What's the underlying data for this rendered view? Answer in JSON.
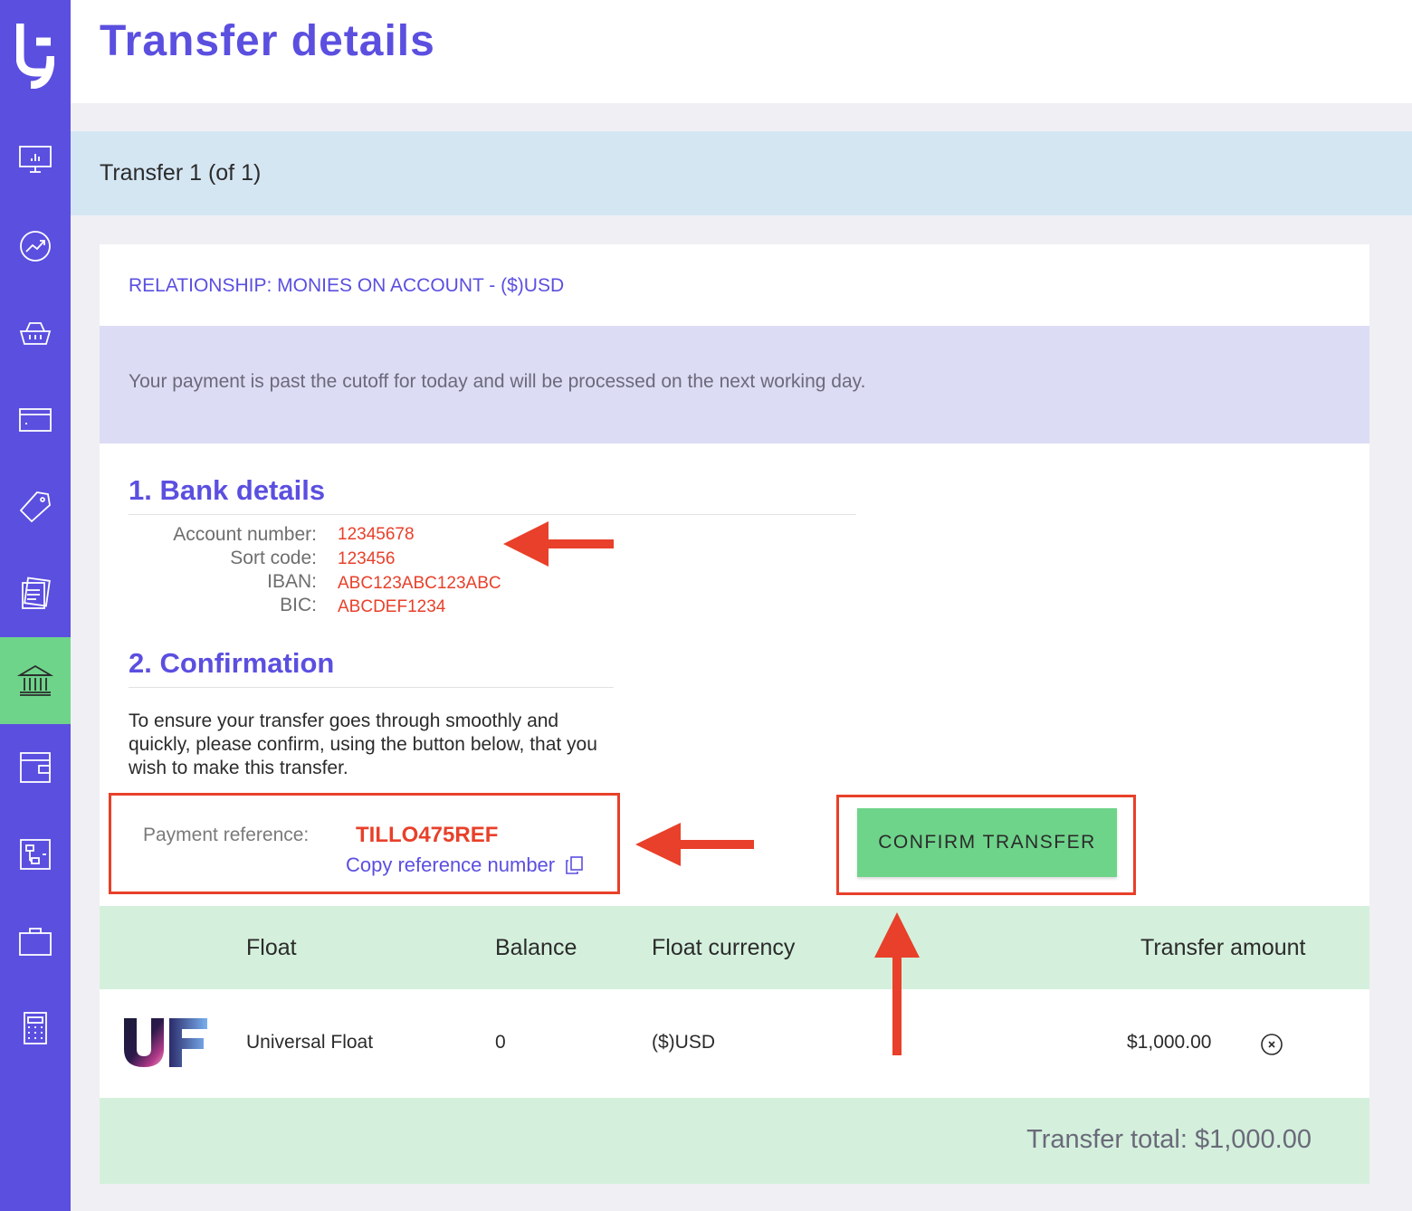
{
  "header": {
    "title": "Transfer details"
  },
  "transfer_bar": {
    "label": "Transfer 1 (of 1)"
  },
  "card": {
    "relationship": "RELATIONSHIP: MONIES ON ACCOUNT - ($)USD",
    "notice": "Your payment is past the cutoff for today and will be processed on the next working day.",
    "bank_details": {
      "title": "1. Bank details",
      "rows": [
        {
          "label": "Account number:",
          "value": "12345678"
        },
        {
          "label": "Sort code:",
          "value": "123456"
        },
        {
          "label": "IBAN:",
          "value": "ABC123ABC123ABC"
        },
        {
          "label": "BIC:",
          "value": "ABCDEF1234"
        }
      ]
    },
    "confirmation": {
      "title": "2. Confirmation",
      "text": "To ensure your transfer goes through smoothly and quickly, please confirm, using the button below, that you wish to make this transfer."
    },
    "reference": {
      "label": "Payment reference:",
      "value": "TILLO475REF",
      "copy_label": "Copy reference number"
    },
    "confirm_button": "CONFIRM TRANSFER"
  },
  "table": {
    "columns": [
      "Float",
      "Balance",
      "Float currency",
      "Transfer amount"
    ],
    "rows": [
      {
        "logo": "UF",
        "float": "Universal Float",
        "balance": "0",
        "currency": "($)USD",
        "amount": "$1,000.00"
      }
    ],
    "total": "Transfer total: $1,000.00"
  },
  "sidebar": {
    "items": [
      {
        "icon": "dashboard-monitor-icon"
      },
      {
        "icon": "trend-chart-icon"
      },
      {
        "icon": "basket-icon"
      },
      {
        "icon": "card-icon"
      },
      {
        "icon": "tag-icon"
      },
      {
        "icon": "documents-icon"
      },
      {
        "icon": "bank-icon",
        "active": true
      },
      {
        "icon": "wallet-icon"
      },
      {
        "icon": "hierarchy-icon"
      },
      {
        "icon": "briefcase-icon"
      },
      {
        "icon": "calculator-icon"
      }
    ]
  },
  "colors": {
    "brand": "#5b4fe0",
    "accent_green": "#6ed48a",
    "annotation_red": "#e8402a",
    "notice_bg": "#dddcf5",
    "table_bg": "#d4f0dc"
  }
}
